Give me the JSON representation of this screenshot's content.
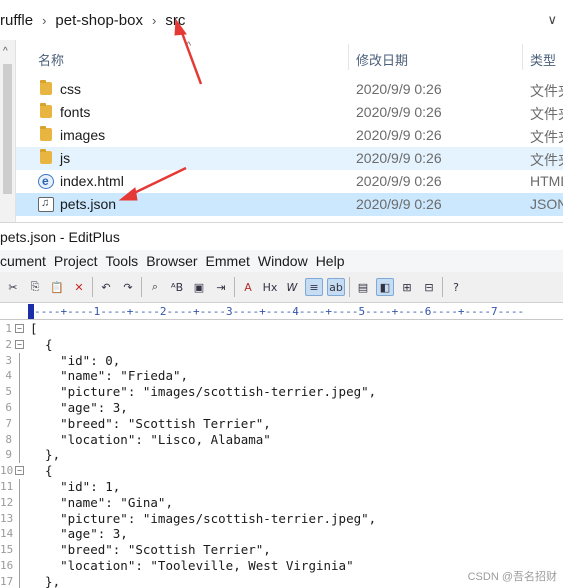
{
  "explorer": {
    "breadcrumb": [
      "ruffle",
      "pet-shop-box",
      "src"
    ],
    "columns": {
      "name": "名称",
      "modified": "修改日期",
      "type": "类型"
    },
    "files": [
      {
        "name": "css",
        "date": "2020/9/9 0:26",
        "type": "文件夹",
        "icon": "folder-icon"
      },
      {
        "name": "fonts",
        "date": "2020/9/9 0:26",
        "type": "文件夹",
        "icon": "folder-icon"
      },
      {
        "name": "images",
        "date": "2020/9/9 0:26",
        "type": "文件夹",
        "icon": "folder-icon"
      },
      {
        "name": "js",
        "date": "2020/9/9 0:26",
        "type": "文件夹",
        "icon": "folder-icon"
      },
      {
        "name": "index.html",
        "date": "2020/9/9 0:26",
        "type": "HTML",
        "icon": "html-file-icon"
      },
      {
        "name": "pets.json",
        "date": "2020/9/9 0:26",
        "type": "JSON",
        "icon": "json-file-icon"
      }
    ]
  },
  "editplus": {
    "title": "pets.json - EditPlus",
    "menu": [
      "cument",
      "Project",
      "Tools",
      "Browser",
      "Emmet",
      "Window",
      "Help"
    ],
    "ruler": "----+----1----+----2----+----3----+----4----+----5----+----6----+----7----",
    "lines": [
      {
        "num": "1",
        "text": "[",
        "fold": "open"
      },
      {
        "num": "2",
        "text": "  {",
        "fold": "open"
      },
      {
        "num": "3",
        "text": "    \"id\": 0,"
      },
      {
        "num": "4",
        "text": "    \"name\": \"Frieda\","
      },
      {
        "num": "5",
        "text": "    \"picture\": \"images/scottish-terrier.jpeg\","
      },
      {
        "num": "6",
        "text": "    \"age\": 3,"
      },
      {
        "num": "7",
        "text": "    \"breed\": \"Scottish Terrier\","
      },
      {
        "num": "8",
        "text": "    \"location\": \"Lisco, Alabama\""
      },
      {
        "num": "9",
        "text": "  },"
      },
      {
        "num": "10",
        "text": "  {",
        "fold": "open"
      },
      {
        "num": "11",
        "text": "    \"id\": 1,"
      },
      {
        "num": "12",
        "text": "    \"name\": \"Gina\","
      },
      {
        "num": "13",
        "text": "    \"picture\": \"images/scottish-terrier.jpeg\","
      },
      {
        "num": "14",
        "text": "    \"age\": 3,"
      },
      {
        "num": "15",
        "text": "    \"breed\": \"Scottish Terrier\","
      },
      {
        "num": "16",
        "text": "    \"location\": \"Tooleville, West Virginia\""
      },
      {
        "num": "17",
        "text": "  },"
      }
    ]
  },
  "watermark": "CSDN @吾名招财",
  "colors": {
    "selected_row": "#cce8ff",
    "hover_row": "#e5f3ff",
    "arrow": "#e53935"
  }
}
